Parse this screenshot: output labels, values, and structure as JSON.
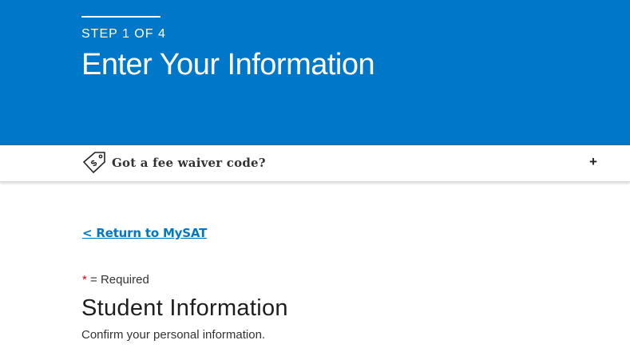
{
  "header": {
    "step": "STEP 1 OF 4",
    "title": "Enter Your Information"
  },
  "fee_waiver": {
    "icon": "price-tag-icon",
    "label": "Got a fee waiver code?",
    "expand_icon": "+"
  },
  "nav": {
    "return_link": "< Return to MySAT"
  },
  "form": {
    "required_star": "*",
    "required_text": " = Required",
    "section_title": "Student Information",
    "section_subtitle": "Confirm your personal information."
  },
  "colors": {
    "brand_blue": "#0077c8",
    "required_red": "#d0021b"
  }
}
